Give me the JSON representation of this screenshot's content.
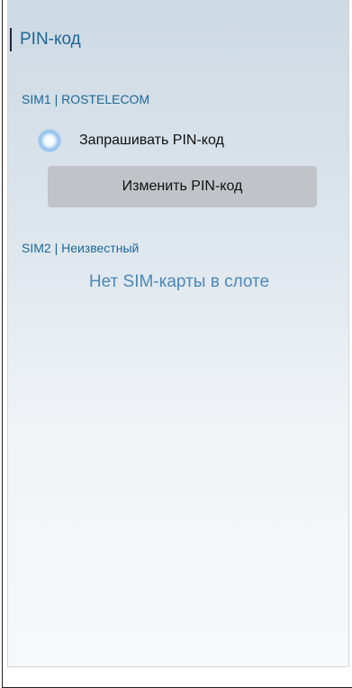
{
  "header": {
    "title": "PIN-код"
  },
  "sim1": {
    "heading": "SIM1 | ROSTELECOM",
    "request_pin_label": "Запрашивать PIN-код",
    "request_pin_enabled": true,
    "change_pin_button": "Изменить PIN-код"
  },
  "sim2": {
    "heading": "SIM2 | Неизвестный",
    "status": "Нет SIM-карты в слоте"
  },
  "colors": {
    "accent": "#1d6795",
    "status_text": "#4b88b8",
    "button_bg": "#c0c4c8"
  }
}
